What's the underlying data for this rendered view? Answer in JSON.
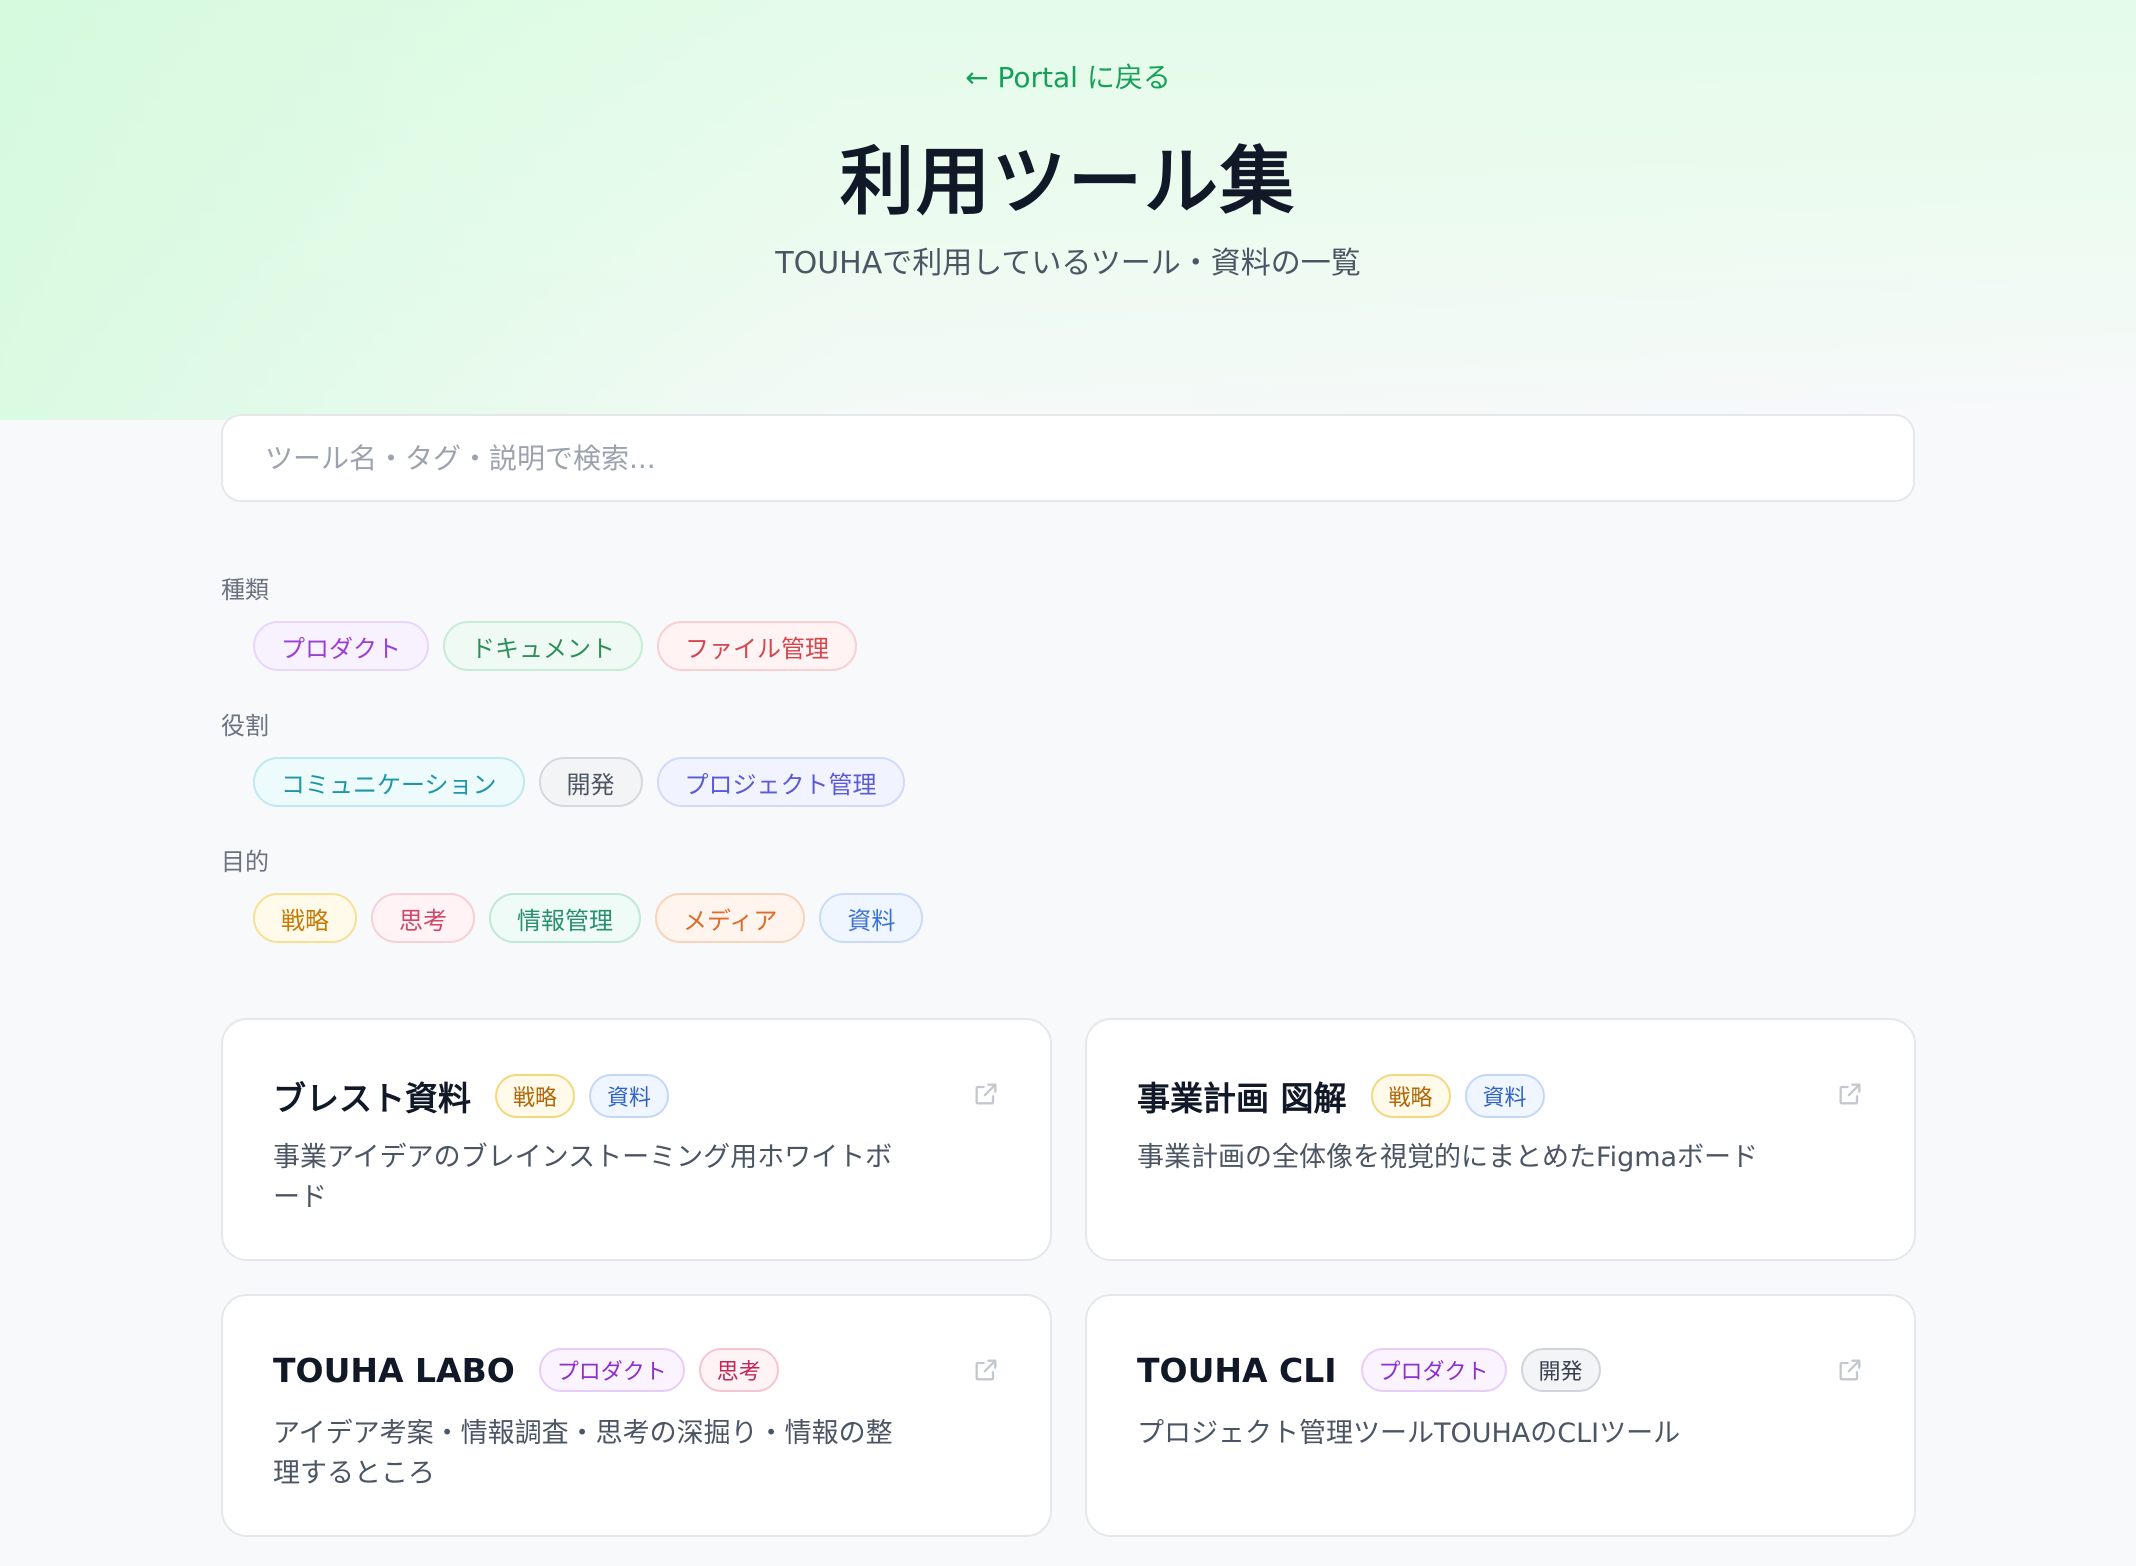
{
  "header": {
    "back_link": "← Portal に戻る",
    "title": "利用ツール集",
    "subtitle": "TOUHAで利用しているツール・資料の一覧"
  },
  "search": {
    "placeholder": "ツール名・タグ・説明で検索...",
    "value": ""
  },
  "filters": [
    {
      "label": "種類",
      "chips": [
        "プロダクト",
        "ドキュメント",
        "ファイル管理"
      ]
    },
    {
      "label": "役割",
      "chips": [
        "コミュニケーション",
        "開発",
        "プロジェクト管理"
      ]
    },
    {
      "label": "目的",
      "chips": [
        "戦略",
        "思考",
        "情報管理",
        "メディア",
        "資料"
      ]
    }
  ],
  "cards": [
    {
      "title": "ブレスト資料",
      "tags": [
        "戦略",
        "資料"
      ],
      "description": "事業アイデアのブレインストーミング用ホワイトボード"
    },
    {
      "title": "事業計画 図解",
      "tags": [
        "戦略",
        "資料"
      ],
      "description": "事業計画の全体像を視覚的にまとめたFigmaボード"
    },
    {
      "title": "TOUHA LABO",
      "tags": [
        "プロダクト",
        "思考"
      ],
      "description": "アイデア考案・情報調査・思考の深掘り・情報の整理するところ"
    },
    {
      "title": "TOUHA CLI",
      "tags": [
        "プロダクト",
        "開発"
      ],
      "description": "プロジェクト管理ツールTOUHAのCLIツール"
    }
  ],
  "icons": {
    "external_link": "external-link-icon"
  },
  "colors": {
    "accent": "#16a05a",
    "title": "#111827"
  }
}
